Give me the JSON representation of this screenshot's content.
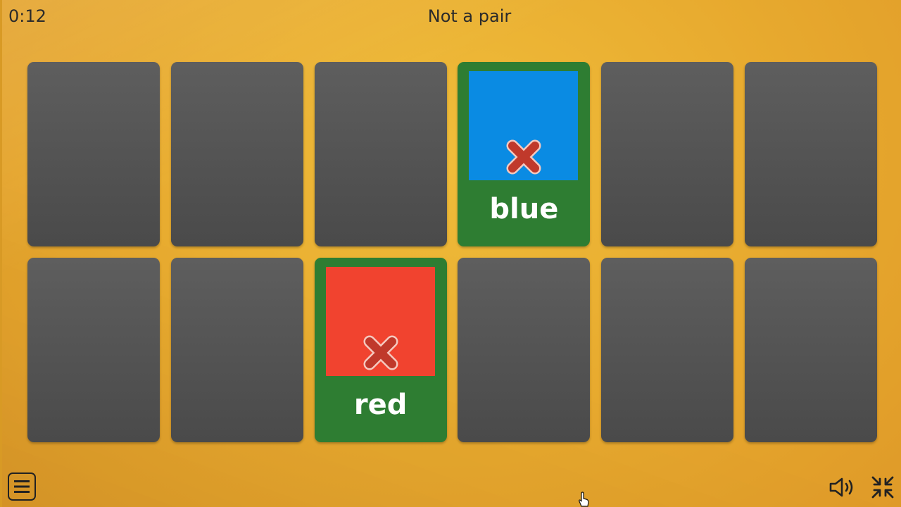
{
  "header": {
    "timer": "0:12",
    "status": "Not a pair"
  },
  "cards": [
    {
      "state": "face-down"
    },
    {
      "state": "face-down"
    },
    {
      "state": "face-down"
    },
    {
      "state": "revealed",
      "word": "blue",
      "swatch_color": "#0a8be3",
      "result": "x-mark-icon"
    },
    {
      "state": "face-down"
    },
    {
      "state": "face-down"
    },
    {
      "state": "face-down"
    },
    {
      "state": "face-down"
    },
    {
      "state": "revealed",
      "word": "red",
      "swatch_color": "#f1432f",
      "result": "x-mark-icon"
    },
    {
      "state": "face-down"
    },
    {
      "state": "face-down"
    },
    {
      "state": "face-down"
    }
  ],
  "colors": {
    "card_back": "#555555",
    "card_revealed_frame": "#2e7d32",
    "mismatch_mark": "#c0392b",
    "background": "#e7a92e"
  },
  "toolbar": {
    "menu_icon": "menu-icon",
    "sound_icon": "speaker-icon",
    "fullscreen_icon": "exit-fullscreen-icon"
  }
}
